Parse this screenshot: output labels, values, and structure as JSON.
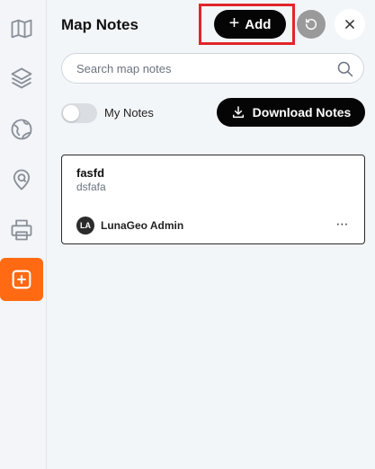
{
  "rail": {
    "items": [
      {
        "icon": "map-icon",
        "active": false
      },
      {
        "icon": "layers-icon",
        "active": false
      },
      {
        "icon": "globe-icon",
        "active": false
      },
      {
        "icon": "location-search-icon",
        "active": false
      },
      {
        "icon": "printer-icon",
        "active": false
      },
      {
        "icon": "note-add-icon",
        "active": true
      }
    ]
  },
  "header": {
    "title": "Map Notes",
    "add_label": "Add"
  },
  "search": {
    "placeholder": "Search map notes",
    "value": ""
  },
  "filters": {
    "my_notes_label": "My Notes",
    "my_notes_on": false,
    "download_label": "Download Notes"
  },
  "notes": [
    {
      "title": "fasfd",
      "body": "dsfafa",
      "author_initials": "LA",
      "author": "LunaGeo Admin",
      "more": "⋯"
    }
  ],
  "colors": {
    "accent": "#ff6a13",
    "highlight": "#e0262b",
    "primary_button": "#050505"
  }
}
